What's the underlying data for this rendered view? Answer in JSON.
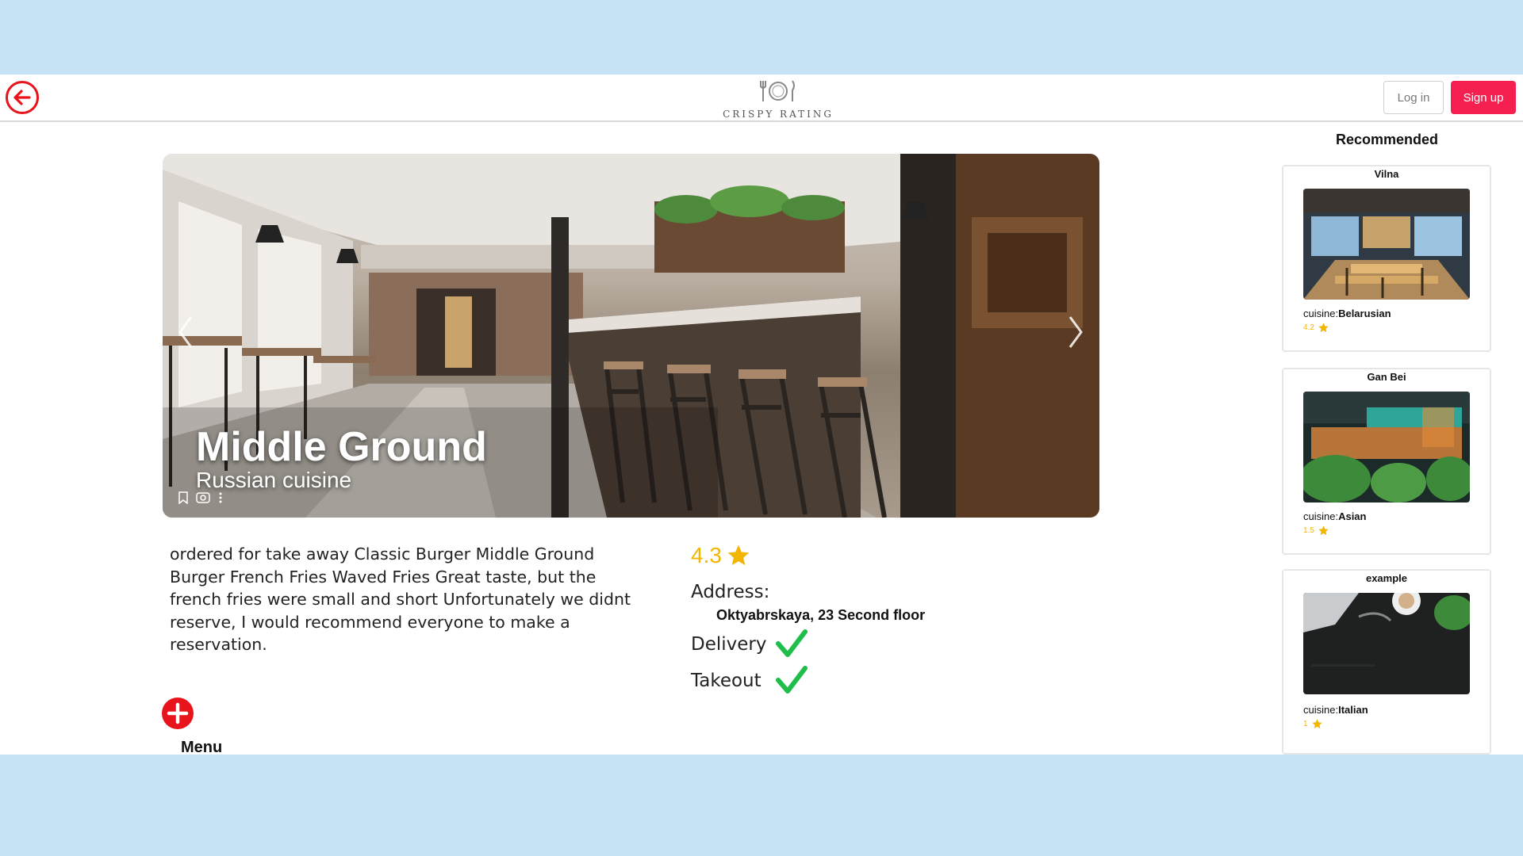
{
  "header": {
    "logo_text": "CRISPY RATING",
    "login_label": "Log in",
    "signup_label": "Sign up"
  },
  "restaurant": {
    "name": "Middle Ground",
    "cuisine": "Russian cuisine",
    "description": "ordered for take away Classic Burger Middle Ground Burger French Fries Waved Fries Great taste, but the french fries were small and short Unfortunately we didnt reserve, I would recommend everyone to make a reservation.",
    "rating": "4.3",
    "address_label": "Address:",
    "address": "Oktyabrskaya, 23 Second floor",
    "delivery_label": "Delivery",
    "takeout_label": "Takeout",
    "menu_label": "Menu"
  },
  "recommended": {
    "title": "Recommended",
    "cuisine_prefix": "cuisine:",
    "cards": [
      {
        "name": "Vilna",
        "cuisine": "Belarusian",
        "rating": "4.2"
      },
      {
        "name": "Gan Bei",
        "cuisine": "Asian",
        "rating": "1.5"
      },
      {
        "name": "example",
        "cuisine": "Italian",
        "rating": "1"
      }
    ]
  },
  "colors": {
    "accent_red": "#e8141c",
    "signup_pink": "#f5204f",
    "star_gold": "#f2b600",
    "check_green": "#1fbe4a",
    "page_bg": "#c5e3f5"
  }
}
